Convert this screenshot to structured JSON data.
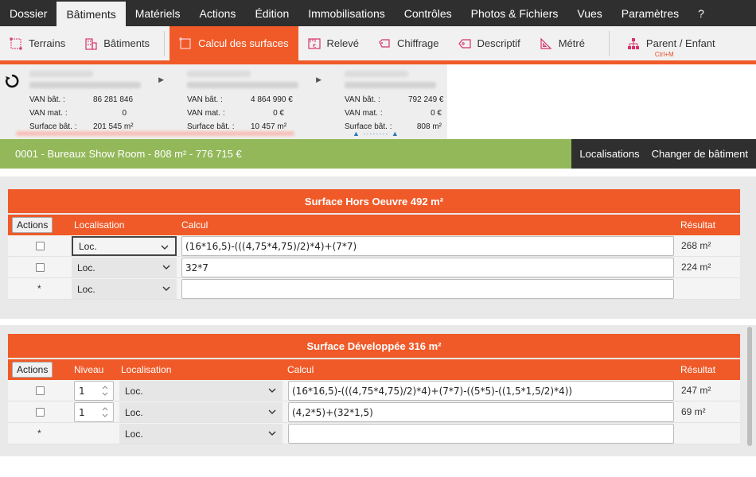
{
  "menu": {
    "items": [
      "Dossier",
      "Bâtiments",
      "Matériels",
      "Actions",
      "Édition",
      "Immobilisations",
      "Contrôles",
      "Photos & Fichiers",
      "Vues",
      "Paramètres",
      "?"
    ],
    "active": "Bâtiments"
  },
  "toolbar": {
    "terrains": "Terrains",
    "batiments": "Bâtiments",
    "calcul_surfaces": "Calcul des surfaces",
    "releve": "Relevé",
    "chiffrage": "Chiffrage",
    "descriptif": "Descriptif",
    "metre": "Métré",
    "parent_enfant": "Parent / Enfant",
    "parent_enfant_shortcut": "Ctrl+M"
  },
  "cards": [
    {
      "van_bat_label": "VAN bât. :",
      "van_bat": "86 281 846",
      "van_mat_label": "VAN mat. :",
      "van_mat": "0",
      "surface_label": "Surface bât. :",
      "surface": "201 545 m²"
    },
    {
      "van_bat_label": "VAN bât. :",
      "van_bat": "4 864 990 €",
      "van_mat_label": "VAN mat. :",
      "van_mat": "0 €",
      "surface_label": "Surface bât. :",
      "surface": "10 457 m²"
    },
    {
      "van_bat_label": "VAN bât. :",
      "van_bat": "792 249 €",
      "van_mat_label": "VAN mat. :",
      "van_mat": "0 €",
      "surface_label": "Surface bât. :",
      "surface": "808 m²"
    }
  ],
  "titlebar": {
    "title": "0001 - Bureaux Show Room - 808 m² - 776 715 €",
    "localisations": "Localisations",
    "changer": "Changer de bâtiment"
  },
  "shon": {
    "title": "Surface Hors Oeuvre 492 m²",
    "headers": {
      "actions": "Actions",
      "localisation": "Localisation",
      "calcul": "Calcul",
      "resultat": "Résultat"
    },
    "rows": [
      {
        "loc": "Loc.",
        "calcul": "(16*16,5)-(((4,75*4,75)/2)*4)+(7*7)",
        "resultat": "268 m²"
      },
      {
        "loc": "Loc.",
        "calcul": "32*7",
        "resultat": "224 m²"
      }
    ],
    "new_row": {
      "marker": "*",
      "loc": "Loc."
    }
  },
  "sd": {
    "title": "Surface Développée 316 m²",
    "headers": {
      "actions": "Actions",
      "niveau": "Niveau",
      "localisation": "Localisation",
      "calcul": "Calcul",
      "resultat": "Résultat"
    },
    "rows": [
      {
        "niveau": "1",
        "loc": "Loc.",
        "calcul": "(16*16,5)-(((4,75*4,75)/2)*4)+(7*7)-((5*5)-((1,5*1,5/2)*4))",
        "resultat": "247 m²"
      },
      {
        "niveau": "1",
        "loc": "Loc.",
        "calcul": "(4,2*5)+(32*1,5)",
        "resultat": "69 m²"
      }
    ],
    "new_row": {
      "marker": "*",
      "loc": "Loc."
    }
  },
  "colors": {
    "accent": "#f05a28",
    "green": "#93b85a",
    "dark": "#2f2f2f"
  }
}
